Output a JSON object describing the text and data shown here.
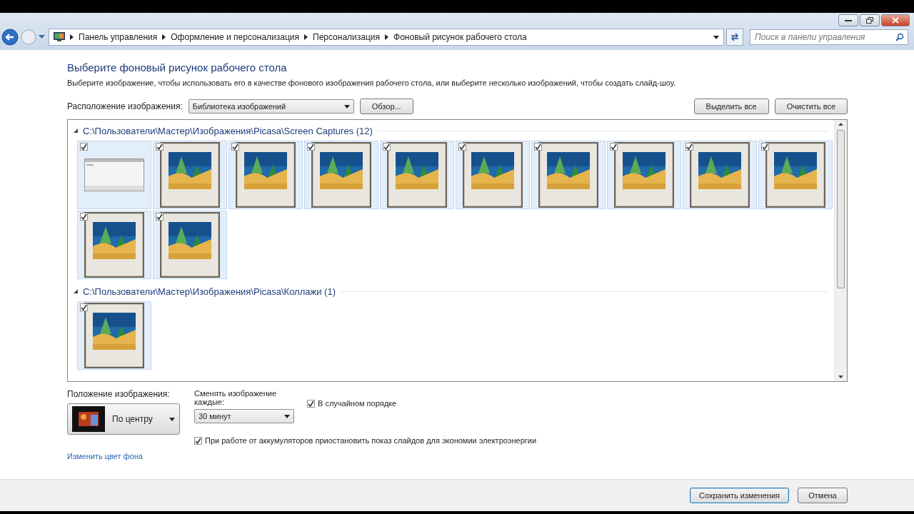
{
  "address_bar": {
    "breadcrumbs": [
      "Панель управления",
      "Оформление и персонализация",
      "Персонализация",
      "Фоновый рисунок рабочего стола"
    ]
  },
  "search": {
    "placeholder": "Поиск в панели управления"
  },
  "heading": "Выберите фоновый рисунок рабочего стола",
  "description": "Выберите изображение, чтобы использовать его в качестве фонового изображения рабочего стола, или выберите несколько изображений, чтобы создать слайд-шоу.",
  "location": {
    "label": "Расположение изображения:",
    "value": "Библиотека изображений",
    "browse": "Обзор..."
  },
  "select_all": "Выделить все",
  "clear_all": "Очистить все",
  "groups": [
    {
      "title": "C:\\Пользователи\\Мастер\\Изображения\\Picasa\\Screen Captures (12)",
      "expanded": true,
      "tiles": [
        {
          "kind": "screenshot",
          "checked": true
        },
        {
          "kind": "picture",
          "checked": true
        },
        {
          "kind": "picture",
          "checked": true
        },
        {
          "kind": "picture",
          "checked": true
        },
        {
          "kind": "picture",
          "checked": true
        },
        {
          "kind": "picture",
          "checked": true
        },
        {
          "kind": "picture",
          "checked": true
        },
        {
          "kind": "picture",
          "checked": true
        },
        {
          "kind": "picture",
          "checked": true
        },
        {
          "kind": "picture",
          "checked": true
        },
        {
          "kind": "picture",
          "checked": true
        },
        {
          "kind": "picture",
          "checked": true
        }
      ]
    },
    {
      "title": "C:\\Пользователи\\Мастер\\Изображения\\Picasa\\Коллажи (1)",
      "expanded": true,
      "tiles": [
        {
          "kind": "picture",
          "checked": true
        }
      ]
    }
  ],
  "position": {
    "label": "Положение изображения:",
    "value": "По центру"
  },
  "interval": {
    "label": "Сменять изображение каждые:",
    "value": "30 минут"
  },
  "shuffle": {
    "label": "В случайном порядке",
    "checked": true
  },
  "battery": {
    "label": "При работе от аккумуляторов приостановить показ слайдов для экономии электроэнергии",
    "checked": true
  },
  "change_color": "Изменить цвет фона",
  "buttons": [
    {
      "label": "Сохранить изменения",
      "default": true
    },
    {
      "label": "Отмена",
      "default": false
    }
  ]
}
